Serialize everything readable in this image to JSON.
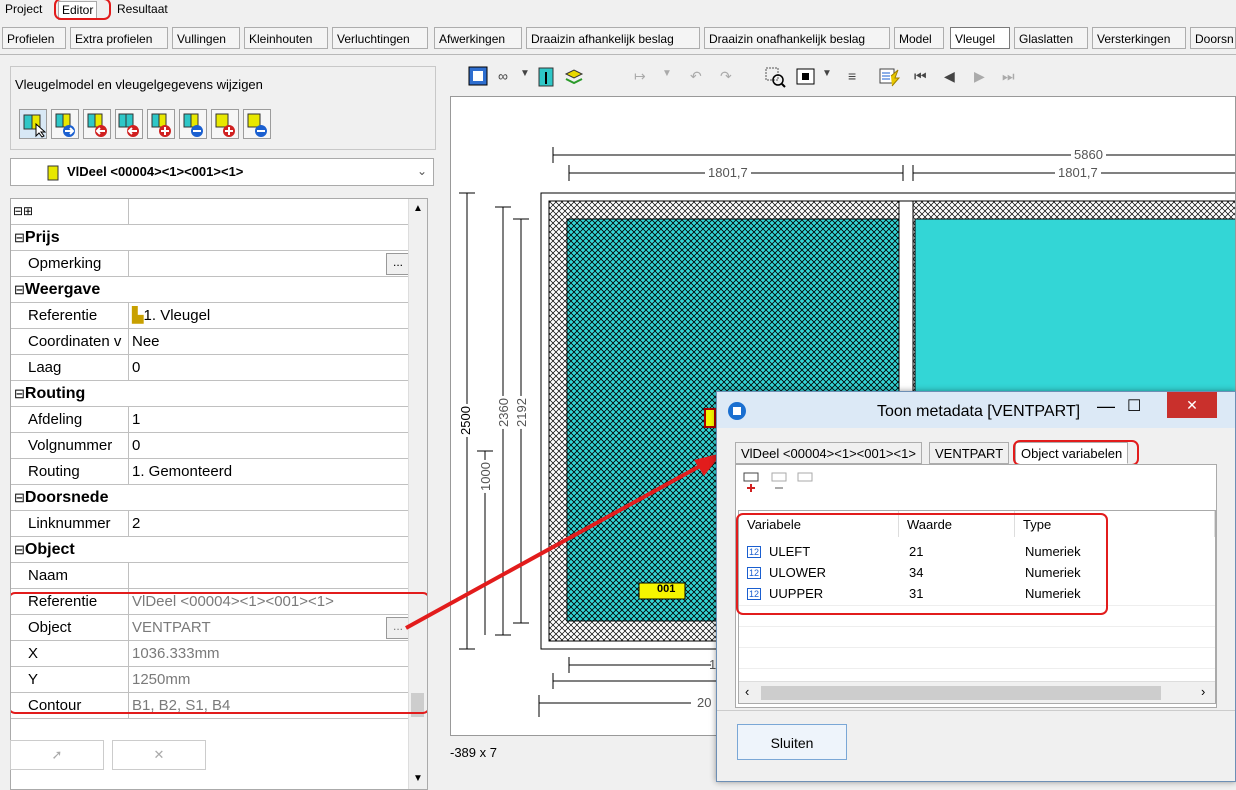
{
  "menu": [
    {
      "label": "Project",
      "active": false
    },
    {
      "label": "Editor",
      "active": true
    },
    {
      "label": "Resultaat",
      "active": false
    }
  ],
  "tabs": [
    {
      "label": "Profielen",
      "active": false
    },
    {
      "label": "Extra profielen",
      "active": false
    },
    {
      "label": "Vullingen",
      "active": false
    },
    {
      "label": "Kleinhouten",
      "active": false
    },
    {
      "label": "Verluchtingen",
      "active": false
    },
    {
      "label": "Afwerkingen",
      "active": false
    },
    {
      "label": "Draaizin afhankelijk beslag",
      "active": false
    },
    {
      "label": "Draaizin onafhankelijk beslag",
      "active": false
    },
    {
      "label": "Model",
      "active": false
    },
    {
      "label": "Vleugel",
      "active": true
    },
    {
      "label": "Glaslatten",
      "active": false
    },
    {
      "label": "Versterkingen",
      "active": false
    },
    {
      "label": "Doorsn",
      "active": false
    }
  ],
  "left_panel": {
    "title": "Vleugelmodel en vleugelgegevens wijzigen",
    "combo_value": "VlDeel <00004><1><001><1>"
  },
  "property_grid": {
    "header_expanders": "⊟⊞",
    "rows": [
      {
        "type": "cat",
        "label": "Prijs"
      },
      {
        "type": "prop",
        "label": "Opmerking",
        "value": "",
        "button": true
      },
      {
        "type": "cat",
        "label": "Weergave"
      },
      {
        "type": "prop",
        "label": "Referentie",
        "value": "1. Vleugel",
        "icon": true
      },
      {
        "type": "prop",
        "label": "Coordinaten v",
        "value": "Nee"
      },
      {
        "type": "prop",
        "label": "Laag",
        "value": "0"
      },
      {
        "type": "cat",
        "label": "Routing"
      },
      {
        "type": "prop",
        "label": "Afdeling",
        "value": "1"
      },
      {
        "type": "prop",
        "label": "Volgnummer",
        "value": "0"
      },
      {
        "type": "prop",
        "label": "Routing",
        "value": "1. Gemonteerd"
      },
      {
        "type": "cat",
        "label": "Doorsnede"
      },
      {
        "type": "prop",
        "label": "Linknummer",
        "value": "2"
      },
      {
        "type": "cat",
        "label": "Object"
      },
      {
        "type": "prop",
        "label": "Naam",
        "value": ""
      },
      {
        "type": "prop",
        "label": "Referentie",
        "value": "VlDeel <00004><1><001><1>",
        "gray": true
      },
      {
        "type": "prop",
        "label": "Object",
        "value": "VENTPART",
        "gray": true,
        "button": true
      },
      {
        "type": "prop",
        "label": "X",
        "value": "1036.333mm",
        "gray": true
      },
      {
        "type": "prop",
        "label": "Y",
        "value": "1250mm",
        "gray": true
      },
      {
        "type": "prop",
        "label": "Contour",
        "value": "B1, B2, S1, B4",
        "gray": true
      }
    ]
  },
  "drawing": {
    "dim_top_total": "5860",
    "dim_top_left": "1801,7",
    "dim_top_right": "1801,7",
    "dim_left_outer": "2500",
    "dim_left_mid": "2360",
    "dim_left_inner": "2192",
    "dim_left_handle": "1000",
    "bottom_label_1": "1",
    "bottom_label_2": "20",
    "sash_label": "001",
    "fill_color": "#33d6d6"
  },
  "status": {
    "coords": "-389 x 7"
  },
  "dialog": {
    "title": "Toon metadata [VENTPART]",
    "tabs": [
      {
        "label": "VlDeel <00004><1><001><1>",
        "active": false
      },
      {
        "label": "VENTPART",
        "active": false
      },
      {
        "label": "Object variabelen",
        "active": true
      }
    ],
    "columns": [
      "Variabele",
      "Waarde",
      "Type"
    ],
    "rows": [
      {
        "variable": "ULEFT",
        "value": "21",
        "type": "Numeriek"
      },
      {
        "variable": "ULOWER",
        "value": "34",
        "type": "Numeriek"
      },
      {
        "variable": "UUPPER",
        "value": "31",
        "type": "Numeriek"
      }
    ],
    "close_button": "Sluiten"
  },
  "colors": {
    "highlight": "#e21c1c",
    "cyan_fill": "#33d6d6",
    "dialog_title_bg": "#dce9f6"
  }
}
